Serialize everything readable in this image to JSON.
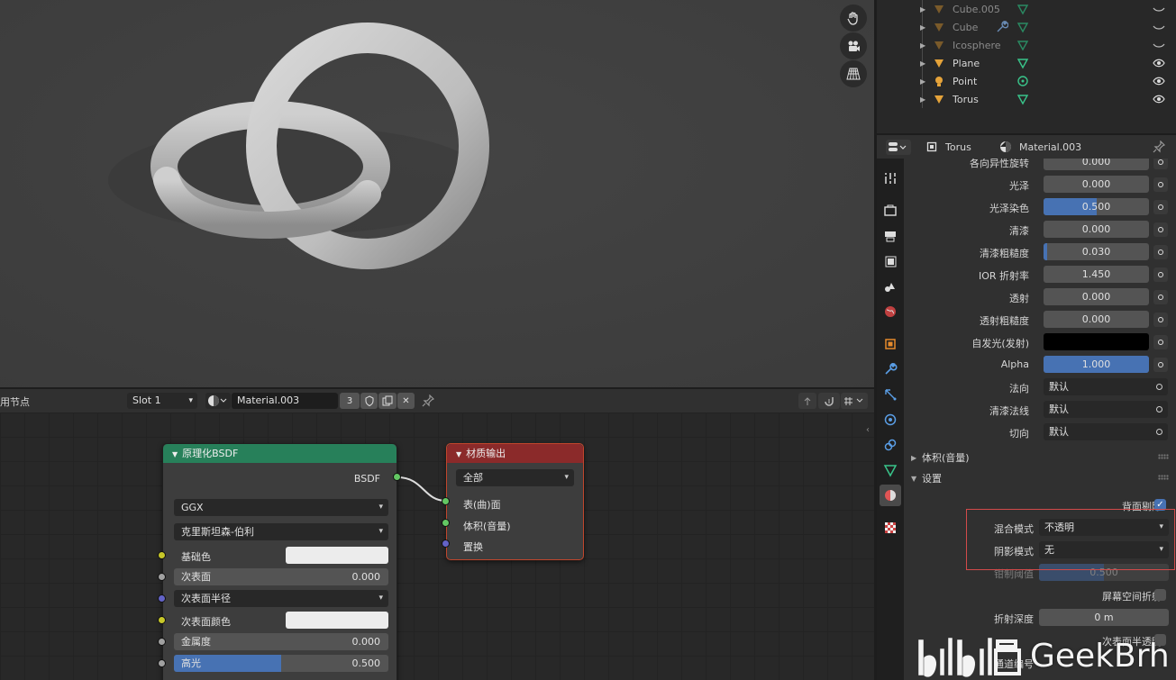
{
  "outliner": {
    "items": [
      {
        "name": "Cube.005",
        "visible": false
      },
      {
        "name": "Cube",
        "visible": false
      },
      {
        "name": "Icosphere",
        "visible": false
      },
      {
        "name": "Plane",
        "visible": true
      },
      {
        "name": "Point",
        "visible": true
      },
      {
        "name": "Torus",
        "visible": true
      }
    ]
  },
  "properties": {
    "header": {
      "object": "Torus",
      "material": "Material.003"
    },
    "rows": [
      {
        "label": "各向异性旋转",
        "value": "0.000",
        "fill": 0
      },
      {
        "label": "光泽",
        "value": "0.000",
        "fill": 0
      },
      {
        "label": "光泽染色",
        "value": "0.500",
        "fill": 0.5
      },
      {
        "label": "清漆",
        "value": "0.000",
        "fill": 0
      },
      {
        "label": "清漆粗糙度",
        "value": "0.030",
        "fill": 0.03
      },
      {
        "label": "IOR 折射率",
        "value": "1.450",
        "fill": 0
      },
      {
        "label": "透射",
        "value": "0.000",
        "fill": 0
      },
      {
        "label": "透射粗糙度",
        "value": "0.000",
        "fill": 0
      },
      {
        "label": "自发光(发射)",
        "value": "",
        "color": "#000000"
      },
      {
        "label": "Alpha",
        "value": "1.000",
        "fill": 1.0
      }
    ],
    "vector_rows": [
      {
        "label": "法向",
        "value": "默认"
      },
      {
        "label": "清漆法线",
        "value": "默认"
      },
      {
        "label": "切向",
        "value": "默认"
      }
    ],
    "panels": {
      "volume": "体积(音量)",
      "settings": "设置"
    },
    "settings": {
      "backface_culling": "背面剔除",
      "blend_mode_label": "混合模式",
      "blend_mode_value": "不透明",
      "shadow_mode_label": "阴影模式",
      "shadow_mode_value": "无",
      "clip_threshold_label": "钳制阈值",
      "clip_threshold_value": "0.500",
      "screen_space_refraction": "屏幕空间折射",
      "refraction_depth_label": "折射深度",
      "refraction_depth_value": "0 m",
      "sss_translucency": "次表面半透明",
      "pass_index_label": "通道编号"
    }
  },
  "node_editor": {
    "header": {
      "use_nodes": "用节点",
      "slot": "Slot 1",
      "material": "Material.003",
      "users": "3"
    },
    "bsdf_node": {
      "title": "原理化BSDF",
      "output": "BSDF",
      "distribution": "GGX",
      "subsurface_method": "克里斯坦森-伯利",
      "base_color": "基础色",
      "subsurface": {
        "label": "次表面",
        "value": "0.000"
      },
      "subsurface_radius": "次表面半径",
      "subsurface_color": "次表面颜色",
      "metallic": {
        "label": "金属度",
        "value": "0.000"
      },
      "specular": {
        "label": "高光",
        "value": "0.500",
        "fill": 0.5
      }
    },
    "output_node": {
      "title": "材质输出",
      "target": "全部",
      "inputs": [
        "表(曲)面",
        "体积(音量)",
        "置换"
      ]
    }
  },
  "watermark": {
    "text": "GeekBrh",
    "logo": "bilibili"
  },
  "colors": {
    "accent": "#4772b3",
    "bsdf_header": "#27805a",
    "output_header": "#8b2a2a",
    "highlight": "#d24a4a"
  }
}
